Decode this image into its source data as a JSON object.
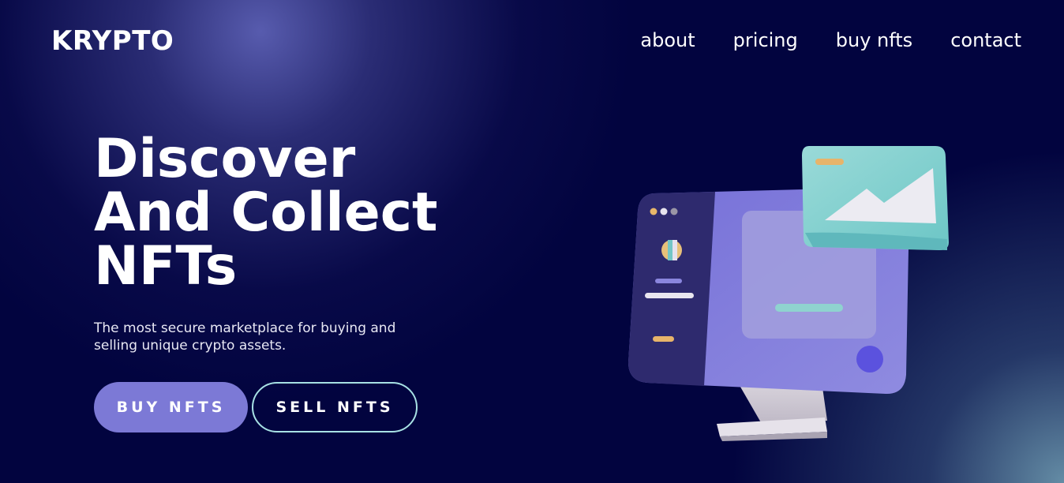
{
  "header": {
    "logo": "KRYPTO",
    "nav": [
      "about",
      "pricing",
      "buy nfts",
      "contact"
    ]
  },
  "hero": {
    "title_lines": [
      "Discover",
      "And Collect",
      "NFTs"
    ],
    "subtitle": "The most secure marketplace for buying and selling unique crypto assets.",
    "buttons": {
      "buy": "BUY NFTS",
      "sell": "SELL NFTS"
    }
  },
  "illustration": {
    "icon": "computer-monitor-illustration"
  },
  "colors": {
    "background": "#02043f",
    "accent_purple": "#7c79d6",
    "accent_teal": "#a7e1e4"
  }
}
